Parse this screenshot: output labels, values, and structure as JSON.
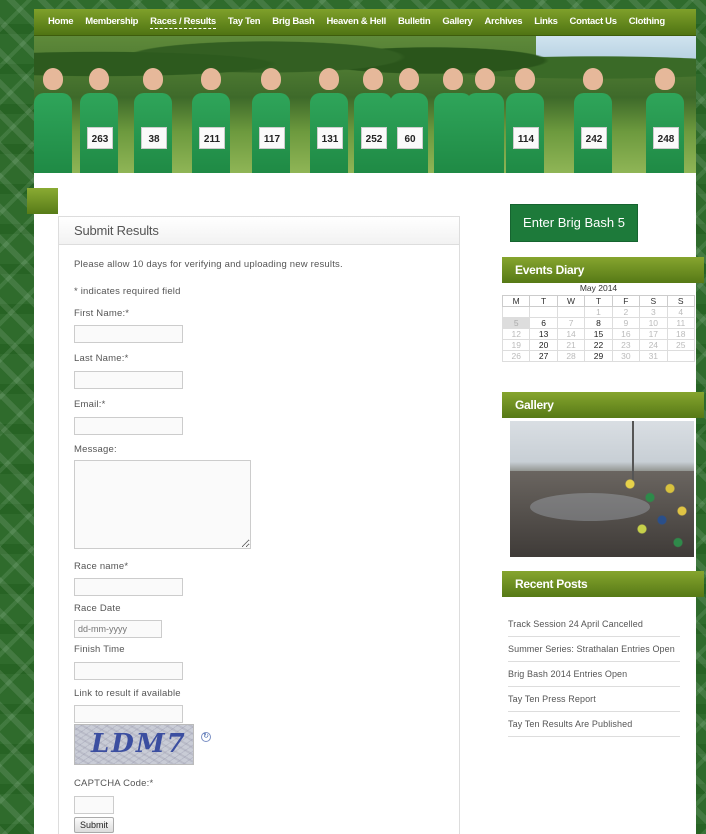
{
  "nav": {
    "items": [
      "Home",
      "Membership",
      "Races / Results",
      "Tay Ten",
      "Brig Bash",
      "Heaven & Hell",
      "Bulletin",
      "Gallery",
      "Archives",
      "Links",
      "Contact Us",
      "Clothing"
    ],
    "active": "Races / Results"
  },
  "header": {
    "bibs": [
      "263",
      "38",
      "211",
      "117",
      "131",
      "252",
      "60",
      "114",
      "242",
      "248"
    ]
  },
  "form": {
    "title": "Submit Results",
    "intro": "Please allow 10 days for verifying and uploading new results.",
    "required_note": "* indicates required field",
    "first_name_label": "First Name:*",
    "last_name_label": "Last Name:*",
    "email_label": "Email:*",
    "message_label": "Message:",
    "race_name_label": "Race name*",
    "race_date_label": "Race Date",
    "race_date_placeholder": "dd-mm-yyyy",
    "finish_time_label": "Finish Time",
    "link_label": "Link to result if available",
    "captcha_text": "LDM7",
    "captcha_label": "CAPTCHA Code:*",
    "submit_label": "Submit"
  },
  "sidebar": {
    "brig_bash_button": "Enter Brig Bash 5",
    "events_title": "Events Diary",
    "calendar": {
      "caption": "May  2014",
      "days": [
        "M",
        "T",
        "W",
        "T",
        "F",
        "S",
        "S"
      ],
      "weeks": [
        [
          "",
          "",
          "",
          "1",
          "2",
          "3",
          "4"
        ],
        [
          "5",
          "6",
          "7",
          "8",
          "9",
          "10",
          "11"
        ],
        [
          "12",
          "13",
          "14",
          "15",
          "16",
          "17",
          "18"
        ],
        [
          "19",
          "20",
          "21",
          "22",
          "23",
          "24",
          "25"
        ],
        [
          "26",
          "27",
          "28",
          "29",
          "30",
          "31",
          ""
        ]
      ]
    },
    "gallery_title": "Gallery",
    "posts_title": "Recent Posts",
    "posts": [
      "Track Session 24 April Cancelled",
      "Summer Series: Strathalan Entries Open",
      "Brig Bash 2014 Entries Open",
      "Tay Ten Press Report",
      "Tay Ten Results Are Published"
    ]
  },
  "colors": {
    "nav_green": "#6a8c20",
    "button_green": "#1d7a3a",
    "vest_green": "#2fa55a"
  }
}
